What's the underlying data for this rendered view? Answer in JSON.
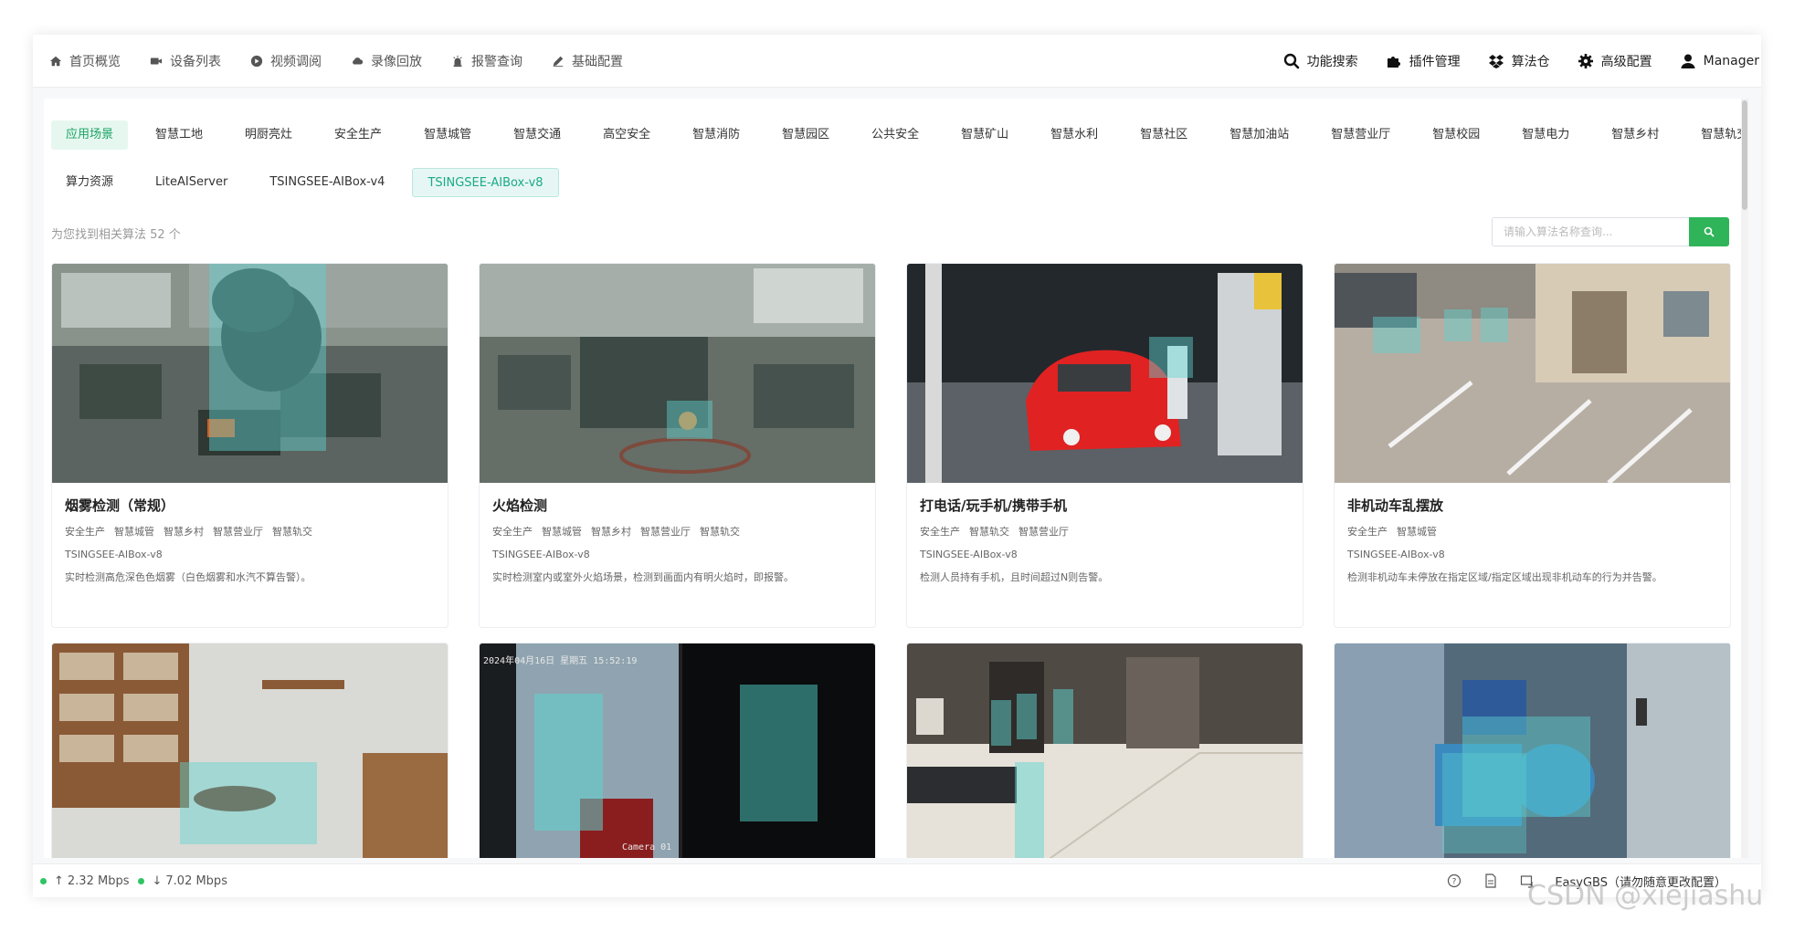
{
  "nav": {
    "items": [
      {
        "label": "首页概览",
        "icon": "home-icon"
      },
      {
        "label": "设备列表",
        "icon": "camera-icon"
      },
      {
        "label": "视频调阅",
        "icon": "play-icon"
      },
      {
        "label": "录像回放",
        "icon": "cloud-icon"
      },
      {
        "label": "报警查询",
        "icon": "alarm-icon"
      },
      {
        "label": "基础配置",
        "icon": "edit-icon"
      }
    ],
    "right": [
      {
        "label": "功能搜索",
        "icon": "search-icon"
      },
      {
        "label": "插件管理",
        "icon": "puzzle-icon"
      },
      {
        "label": "算法仓",
        "icon": "dropbox-icon"
      },
      {
        "label": "高级配置",
        "icon": "gear-icon"
      },
      {
        "label": "Manager",
        "icon": "user-icon"
      }
    ]
  },
  "scenes": {
    "row1": [
      "应用场景",
      "智慧工地",
      "明厨亮灶",
      "安全生产",
      "智慧城管",
      "智慧交通",
      "高空安全",
      "智慧消防",
      "智慧园区",
      "公共安全",
      "智慧矿山",
      "智慧水利",
      "智慧社区",
      "智慧加油站",
      "智慧营业厅",
      "智慧校园",
      "智慧电力",
      "智慧乡村",
      "智慧轨交"
    ],
    "row2": [
      "算力资源",
      "LiteAIServer",
      "TSINGSEE-AIBox-v4",
      "TSINGSEE-AIBox-v8"
    ]
  },
  "result": {
    "found_text": "为您找到相关算法 52 个",
    "search_placeholder": "请输入算法名称查询..."
  },
  "cards": [
    {
      "title": "烟雾检测（常规）",
      "tags": [
        "安全生产",
        "智慧城管",
        "智慧乡村",
        "智慧营业厅",
        "智慧轨交"
      ],
      "model": "TSINGSEE-AIBox-v8",
      "desc": "实时检测高危深色色烟雾（白色烟雾和水汽不算告警）。"
    },
    {
      "title": "火焰检测",
      "tags": [
        "安全生产",
        "智慧城管",
        "智慧乡村",
        "智慧营业厅",
        "智慧轨交"
      ],
      "model": "TSINGSEE-AIBox-v8",
      "desc": "实时检测室内或室外火焰场景，检测到画面内有明火焰时，即报警。"
    },
    {
      "title": "打电话/玩手机/携带手机",
      "tags": [
        "安全生产",
        "智慧轨交",
        "智慧营业厅"
      ],
      "model": "TSINGSEE-AIBox-v8",
      "desc": "检测人员持有手机，且时间超过N则告警。"
    },
    {
      "title": "非机动车乱摆放",
      "tags": [
        "安全生产",
        "智慧城管"
      ],
      "model": "TSINGSEE-AIBox-v8",
      "desc": "检测非机动车未停放在指定区域/指定区域出现非机动车的行为并告警。"
    }
  ],
  "thumb_text": {
    "cam_time": "2024年04月16日 星期五 15:52:19",
    "cam_label": "Camera 01"
  },
  "footer": {
    "upload": "2.32 Mbps",
    "download": "7.02 Mbps",
    "app_name": "EasyGBS（请勿随意更改配置）",
    "status_color": "#2fc463"
  },
  "watermark": "CSDN @xiejiashu"
}
